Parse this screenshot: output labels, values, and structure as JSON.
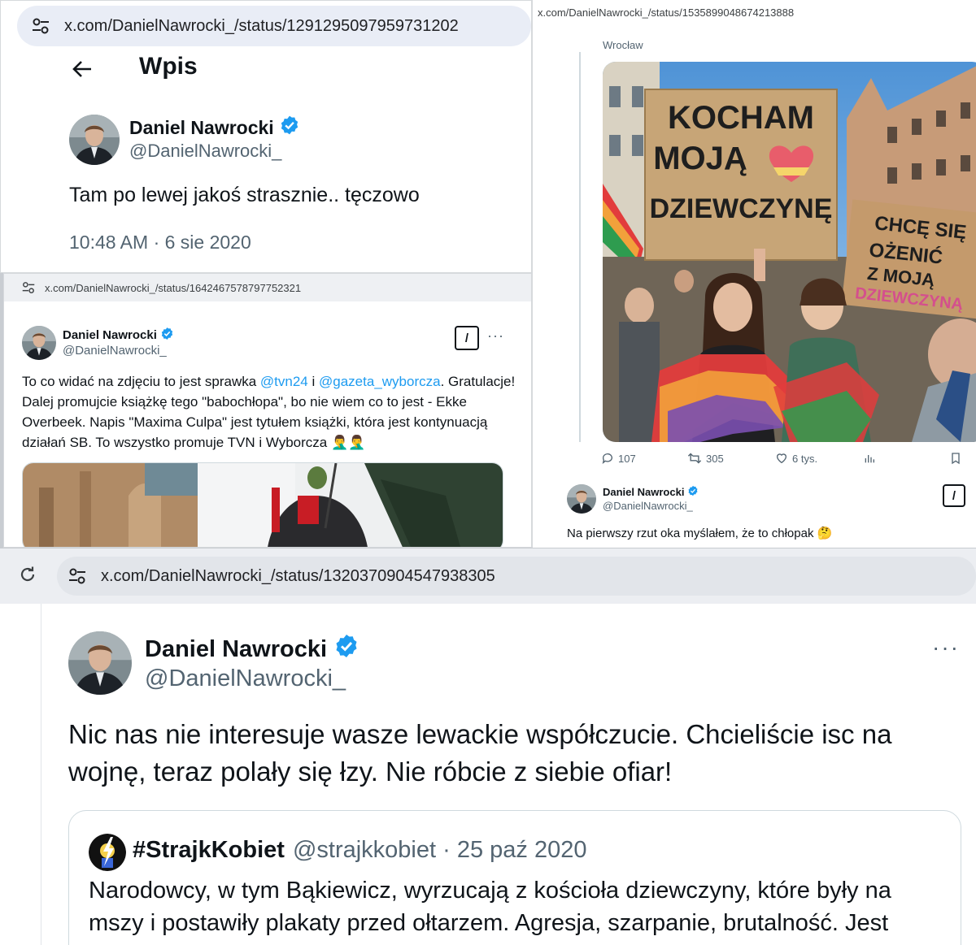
{
  "colors": {
    "verified_badge": "#1d9bf0",
    "link": "#1d9bf0",
    "secondary_text": "#536471",
    "url_bar": "#e9edf6"
  },
  "panel_a": {
    "url": "x.com/DanielNawrocki_/status/1291295097959731202",
    "header_title": "Wpis",
    "author_name": "Daniel Nawrocki",
    "author_handle": "@DanielNawrocki_",
    "tweet_text": "Tam po lewej jakoś strasznie.. tęczowo",
    "timestamp": "10:48 AM · 6 sie 2020"
  },
  "panel_b": {
    "url": "x.com/DanielNawrocki_/status/1642467578797752321",
    "author_name": "Daniel Nawrocki",
    "author_handle": "@DanielNawrocki_",
    "text_1": "To co widać na zdjęciu to jest sprawka ",
    "mention_1": "@tvn24",
    "text_2": " i ",
    "mention_2": "@gazeta_wyborcza",
    "text_3": ". Gratulacje! Dalej promujcie książkę tego \"babochłopa\", bo nie wiem co to jest - Ekke Overbeek. Napis \"Maxima Culpa\" jest tytułem książki, która jest kontynuacją działań SB. To wszystko promuje TVN i Wyborcza 🤦‍♂️🤦‍♂️",
    "grok_label": "/",
    "more_label": "···"
  },
  "panel_c": {
    "url": "x.com/DanielNawrocki_/status/1535899048674213888",
    "location_text": "Wrocław",
    "sign_1": [
      "KOCHAM",
      "MOJĄ",
      "DZIEWCZYNĘ"
    ],
    "sign_2": [
      "CHCĘ SIĘ",
      "OŻENIĆ",
      "Z MOJĄ",
      "DZIEWCZYNĄ"
    ],
    "actions": {
      "replies": "107",
      "reposts": "305",
      "likes": "6 tys."
    },
    "reply_author_name": "Daniel Nawrocki",
    "reply_author_handle": "@DanielNawrocki_",
    "reply_text": "Na pierwszy rzut oka myślałem, że to chłopak 🤔"
  },
  "panel_d": {
    "url": "x.com/DanielNawrocki_/status/1320370904547938305",
    "author_name": "Daniel Nawrocki",
    "author_handle": "@DanielNawrocki_",
    "tweet_text": "Nic nas nie interesuje wasze lewackie współczucie. Chcieliście isc na wojnę, teraz polały się łzy. Nie róbcie z siebie ofiar!",
    "more_label": "···",
    "quote": {
      "name": "#StrajkKobiet",
      "meta": "@strajkkobiet · 25 paź 2020",
      "text": "Narodowcy, w tym Bąkiewicz, wyrzucają z kościoła dziewczyny, które były na mszy i postawiły plakaty przed ołtarzem. Agresja, szarpanie, brutalność. Jest"
    }
  }
}
